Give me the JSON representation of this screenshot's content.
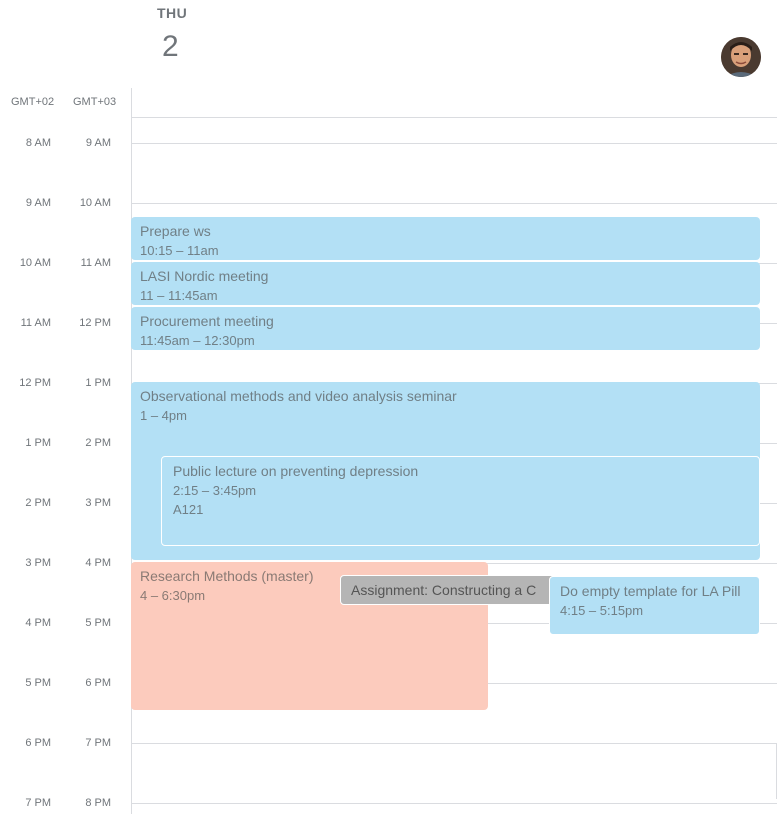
{
  "header": {
    "day_name": "THU",
    "day_number": "2",
    "timezones": [
      "GMT+02",
      "GMT+03"
    ]
  },
  "avatar": {
    "icon": "user-avatar-photo"
  },
  "time_labels_tz1": [
    "8 AM",
    "9 AM",
    "10 AM",
    "11 AM",
    "12 PM",
    "1 PM",
    "2 PM",
    "3 PM",
    "4 PM",
    "5 PM",
    "6 PM",
    "7 PM"
  ],
  "time_labels_tz2": [
    "9 AM",
    "10 AM",
    "11 AM",
    "12 PM",
    "1 PM",
    "2 PM",
    "3 PM",
    "4 PM",
    "5 PM",
    "6 PM",
    "7 PM",
    "8 PM"
  ],
  "events": [
    {
      "title": "Prepare ws",
      "time": "10:15 – 11am"
    },
    {
      "title": "LASI Nordic meeting",
      "time": "11 – 11:45am"
    },
    {
      "title": "Procurement meeting",
      "time": "11:45am – 12:30pm"
    },
    {
      "title": "Observational methods and video analysis seminar",
      "time": "1 – 4pm"
    },
    {
      "title": "Public lecture on preventing depression",
      "time": "2:15 – 3:45pm",
      "location": "A121"
    },
    {
      "title": "Research Methods (master)",
      "time": "4 – 6:30pm"
    },
    {
      "title": "Assignment: Constructing a C"
    },
    {
      "title": "Do empty template for LA Pill",
      "time": "4:15 – 5:15pm"
    }
  ],
  "colors": {
    "blue_event": "#b3e0f5",
    "salmon_event": "#fccbbd",
    "gray_event": "#b5b5b5",
    "grid": "#dadce0"
  }
}
